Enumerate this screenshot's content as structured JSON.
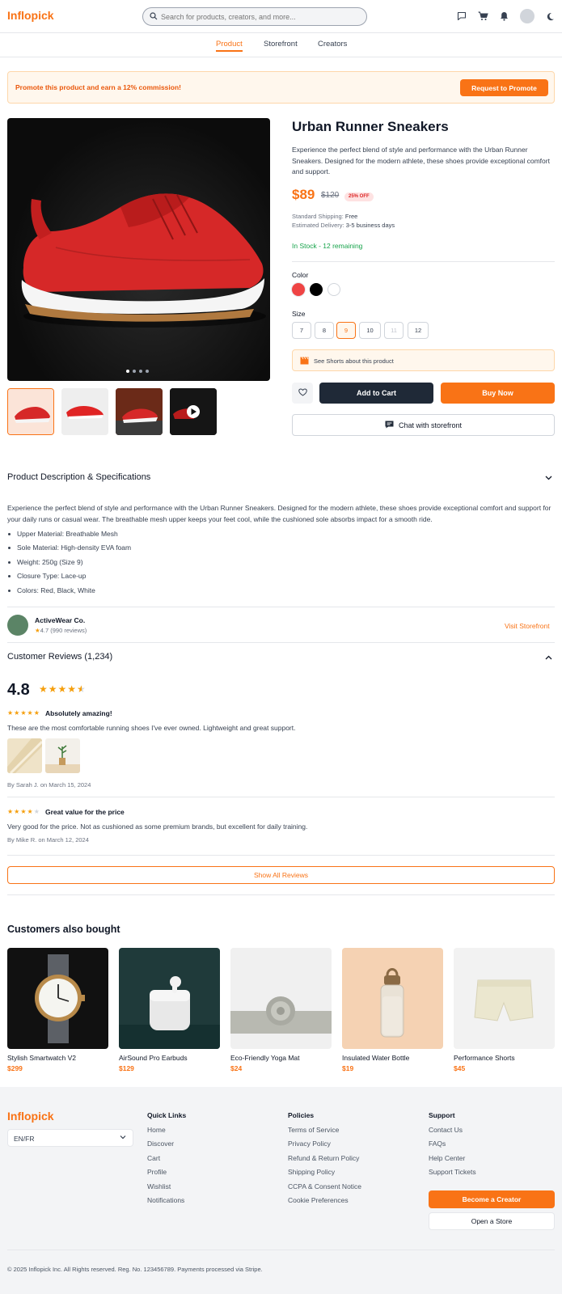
{
  "header": {
    "logo": "Inflopick",
    "search_placeholder": "Search for products, creators, and more...",
    "icons": [
      "chat-icon",
      "cart-icon",
      "bell-icon",
      "avatar",
      "moon-icon"
    ]
  },
  "subnav": {
    "tabs": [
      "Product",
      "Storefront",
      "Creators"
    ],
    "active": "Product"
  },
  "promo": {
    "text": "Promote this product and earn a 12% commission!",
    "button": "Request to Promote"
  },
  "gallery": {
    "image_count": 4,
    "active_index": 0,
    "thumbnails": [
      "shoe-thumb-1",
      "shoe-thumb-2",
      "shoe-thumb-3",
      "shoe-video-thumb"
    ]
  },
  "product": {
    "title": "Urban Runner Sneakers",
    "description": "Experience the perfect blend of style and performance with the Urban Runner Sneakers. Designed for the modern athlete, these shoes provide exceptional comfort and support.",
    "price": "$89",
    "old_price": "$120",
    "discount": "25% OFF",
    "shipping_label": "Standard Shipping:",
    "shipping_value": "Free",
    "delivery_label": "Estimated Delivery:",
    "delivery_value": "3-5 business days",
    "stock": "In Stock - 12 remaining",
    "color_label": "Color",
    "colors": [
      "#ef4444",
      "#000000",
      "#ffffff"
    ],
    "size_label": "Size",
    "sizes": [
      "7",
      "8",
      "9",
      "10",
      "11",
      "12"
    ],
    "selected_size": "9",
    "unavailable_size": "11",
    "shorts_link": "See Shorts about this product",
    "add_to_cart": "Add to Cart",
    "buy_now": "Buy Now",
    "chat": "Chat with storefront"
  },
  "description_section": {
    "title": "Product Description & Specifications",
    "text": "Experience the perfect blend of style and performance with the Urban Runner Sneakers. Designed for the modern athlete, these shoes provide exceptional comfort and support for your daily runs or casual wear. The breathable mesh upper keeps your feet cool, while the cushioned sole absorbs impact for a smooth ride.",
    "specs": [
      "Upper Material: Breathable Mesh",
      "Sole Material: High-density EVA foam",
      "Weight: 250g (Size 9)",
      "Closure Type: Lace-up",
      "Colors: Red, Black, White"
    ]
  },
  "seller": {
    "name": "ActiveWear Co.",
    "rating": "4.7 (990 reviews)",
    "visit": "Visit Storefront"
  },
  "reviews": {
    "title": "Customer Reviews (1,234)",
    "average": "4.8",
    "average_stars": 4.5,
    "items": [
      {
        "stars": 5,
        "title": "Absolutely amazing!",
        "text": "These are the most comfortable running shoes I've ever owned. Lightweight and great support.",
        "by": "By Sarah J. on March 15, 2024"
      },
      {
        "stars": 4,
        "title": "Great value for the price",
        "text": "Very good for the price. Not as cushioned as some premium brands, but excellent for daily training.",
        "by": "By Mike R. on March 12, 2024"
      }
    ],
    "show_all": "Show All Reviews"
  },
  "also_bought": {
    "title": "Customers also bought",
    "items": [
      {
        "name": "Stylish Smartwatch V2",
        "price": "$299"
      },
      {
        "name": "AirSound Pro Earbuds",
        "price": "$129"
      },
      {
        "name": "Eco-Friendly Yoga Mat",
        "price": "$24"
      },
      {
        "name": "Insulated Water Bottle",
        "price": "$19"
      },
      {
        "name": "Performance Shorts",
        "price": "$45"
      }
    ]
  },
  "footer": {
    "logo": "Inflopick",
    "language": "EN/FR",
    "quick_links": {
      "title": "Quick Links",
      "items": [
        "Home",
        "Discover",
        "Cart",
        "Profile",
        "Wishlist",
        "Notifications"
      ]
    },
    "policies": {
      "title": "Policies",
      "items": [
        "Terms of Service",
        "Privacy Policy",
        "Refund & Return Policy",
        "Shipping Policy",
        "CCPA & Consent Notice",
        "Cookie Preferences"
      ]
    },
    "support": {
      "title": "Support",
      "items": [
        "Contact Us",
        "FAQs",
        "Help Center",
        "Support Tickets"
      ]
    },
    "become_creator": "Become a Creator",
    "open_store": "Open a Store",
    "copyright": "© 2025 Inflopick Inc. All Rights reserved. Reg. No. 123456789. Payments processed via Stripe."
  },
  "colors": {
    "accent": "#f97316",
    "dark": "#1f2937",
    "success": "#16a34a"
  }
}
